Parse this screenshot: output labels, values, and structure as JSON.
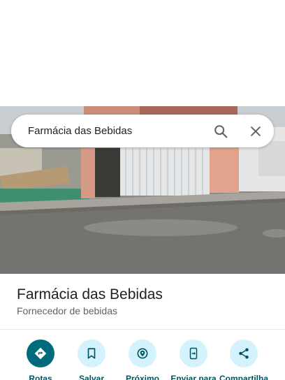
{
  "search": {
    "query": "Farmácia das Bebidas"
  },
  "place": {
    "name": "Farmácia das Bebidas",
    "category": "Fornecedor de bebidas"
  },
  "actions": [
    {
      "label": "Rotas",
      "icon": "directions-icon"
    },
    {
      "label": "Salvar",
      "icon": "bookmark-icon"
    },
    {
      "label": "Próximo",
      "icon": "nearby-icon"
    },
    {
      "label": "Enviar para",
      "icon": "send-to-phone-icon"
    },
    {
      "label": "Compartilha",
      "icon": "share-icon"
    }
  ],
  "colors": {
    "primary_action": "#006b7d",
    "action_bg": "#d3f2fb",
    "action_text": "#00535f"
  }
}
